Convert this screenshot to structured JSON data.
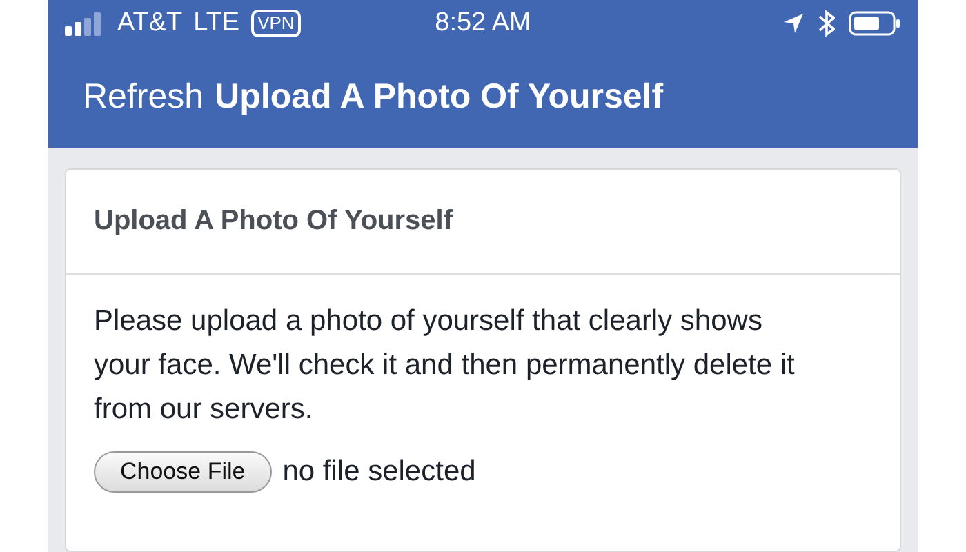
{
  "status_bar": {
    "carrier": "AT&T",
    "network": "LTE",
    "vpn": "VPN",
    "time": "8:52 AM"
  },
  "nav": {
    "action": "Refresh",
    "title": "Upload A Photo Of Yourself"
  },
  "card": {
    "title": "Upload A Photo Of Yourself",
    "text": "Please upload a photo of yourself that clearly shows your face. We'll check it and then permanently delete it from our servers.",
    "file_button": "Choose File",
    "file_status": "no file selected"
  }
}
